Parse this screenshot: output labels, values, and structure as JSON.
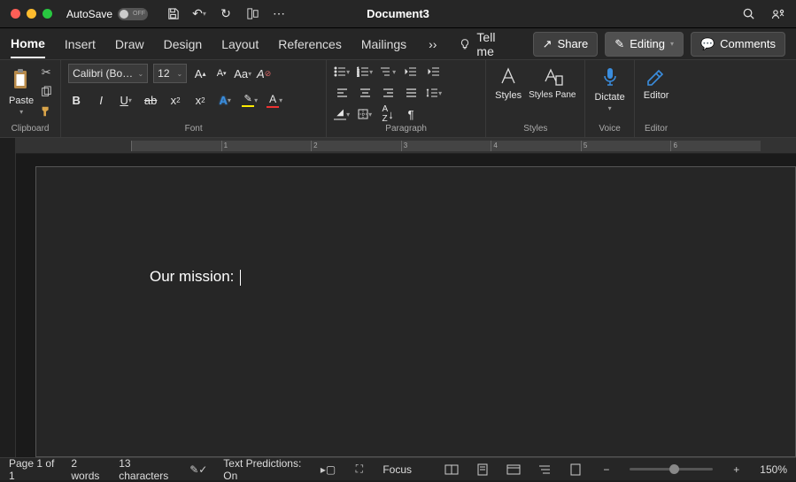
{
  "title": {
    "autosave": "AutoSave",
    "autosave_state": "OFF",
    "document": "Document3"
  },
  "tabs": {
    "home": "Home",
    "insert": "Insert",
    "draw": "Draw",
    "design": "Design",
    "layout": "Layout",
    "references": "References",
    "mailings": "Mailings",
    "tellme": "Tell me"
  },
  "topbtns": {
    "share": "Share",
    "editing": "Editing",
    "comments": "Comments"
  },
  "ribbon": {
    "clipboard": {
      "label": "Clipboard",
      "paste": "Paste"
    },
    "font": {
      "label": "Font",
      "name": "Calibri (Bo…",
      "size": "12"
    },
    "paragraph": {
      "label": "Paragraph"
    },
    "styles": {
      "label": "Styles",
      "styles": "Styles",
      "pane": "Styles Pane"
    },
    "voice": {
      "label": "Voice",
      "dictate": "Dictate"
    },
    "editor": {
      "label": "Editor",
      "editor": "Editor"
    }
  },
  "document": {
    "body": "Our mission: "
  },
  "status": {
    "page": "Page 1 of 1",
    "words": "2 words",
    "chars": "13 characters",
    "predictions": "Text Predictions: On",
    "focus": "Focus",
    "zoom": "150%"
  }
}
